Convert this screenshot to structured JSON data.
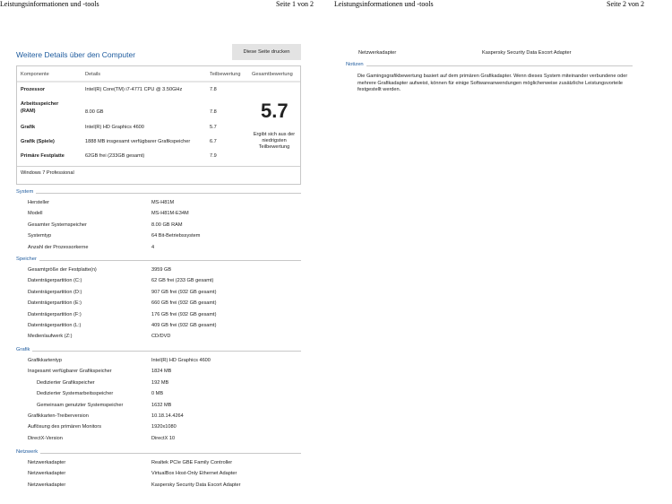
{
  "header": {
    "title": "Leistungsinformationen und -tools",
    "page1": "Seite 1 von 2",
    "page2": "Seite 2 von 2"
  },
  "main": {
    "title": "Weitere Details über den Computer",
    "print_button": "Diese Seite drucken"
  },
  "score_table": {
    "headers": [
      "Komponente",
      "Details",
      "Teilbewertung",
      "Gesamtbewertung"
    ],
    "rows": [
      {
        "component": "Prozessor",
        "details": "Intel(R) Core(TM) i7-4771 CPU @ 3.50GHz",
        "score": "7.8"
      },
      {
        "component": "Arbeitsspeicher (RAM)",
        "details": "8.00 GB",
        "score": "7.8"
      },
      {
        "component": "Grafik",
        "details": "Intel(R) HD Graphics 4600",
        "score": "5.7"
      },
      {
        "component": "Grafik (Spiele)",
        "details": "1888 MB insgesamt verfügbarer Grafikspeicher",
        "score": "6.7"
      },
      {
        "component": "Primäre Festplatte",
        "details": "62GB frei (233GB gesamt)",
        "score": "7.9"
      }
    ],
    "overall": "5.7",
    "overall_note": "Ergibt sich aus der niedrigsten Teilbewertung",
    "os": "Windows 7 Professional"
  },
  "sections": {
    "system": {
      "title": "System",
      "rows": [
        [
          "Hersteller",
          "MS-H81M"
        ],
        [
          "Modell",
          "MS-H81M-E34M"
        ],
        [
          "Gesamter Systemspeicher",
          "8.00 GB RAM"
        ],
        [
          "Systemtyp",
          "64 Bit-Betriebssystem"
        ],
        [
          "Anzahl der Prozessorkerne",
          "4"
        ]
      ]
    },
    "speicher": {
      "title": "Speicher",
      "rows": [
        [
          "Gesamtgröße der Festplatte(n)",
          "3959 GB"
        ],
        [
          "Datenträgerpartition (C:)",
          "62 GB frei (233 GB gesamt)"
        ],
        [
          "Datenträgerpartition (D:)",
          "907 GB frei (932 GB gesamt)"
        ],
        [
          "Datenträgerpartition (E:)",
          "660 GB frei (932 GB gesamt)"
        ],
        [
          "Datenträgerpartition (F:)",
          "176 GB frei (932 GB gesamt)"
        ],
        [
          "Datenträgerpartition (L:)",
          "409 GB frei (932 GB gesamt)"
        ],
        [
          "Medienlaufwerk (Z:)",
          "CD/DVD"
        ]
      ]
    },
    "grafik": {
      "title": "Grafik",
      "rows": [
        [
          "Grafikkartentyp",
          "Intel(R) HD Graphics 4600"
        ],
        [
          "Insgesamt verfügbarer Grafikspeicher",
          "1824 MB"
        ],
        [
          "Dedizierter Grafikspeicher",
          "192 MB"
        ],
        [
          "Dedizierter Systemarbeitsspeicher",
          "0 MB"
        ],
        [
          "Gemeinsam genutzter Systemspeicher",
          "1632 MB"
        ],
        [
          "Grafikkarten-Treiberversion",
          "10.18.14.4264"
        ],
        [
          "Auflösung des primären Monitors",
          "1920x1080"
        ],
        [
          "DirectX-Version",
          "DirectX 10"
        ]
      ]
    },
    "netzwerk": {
      "title": "Netzwerk",
      "rows": [
        [
          "Netzwerkadapter",
          "Realtek PCIe GBE Family Controller"
        ],
        [
          "Netzwerkadapter",
          "VirtualBox Host-Only Ethernet Adapter"
        ],
        [
          "Netzwerkadapter",
          "Kaspersky Security Data Escort Adapter"
        ]
      ]
    }
  },
  "page2": {
    "row": [
      "Netzwerkadapter",
      "Kaspersky Security Data Escort Adapter"
    ],
    "notes_title": "Notizen",
    "notes": "Die Gamingsgrafikbewertung basiert auf dem primären Grafikadapter. Wenn dieses System miteinander verbundene oder mehrere Grafikadapter aufweist, können für einige Softwareanwendungen möglicherweise zusätzliche Leistungsvorteile festgestellt werden."
  }
}
